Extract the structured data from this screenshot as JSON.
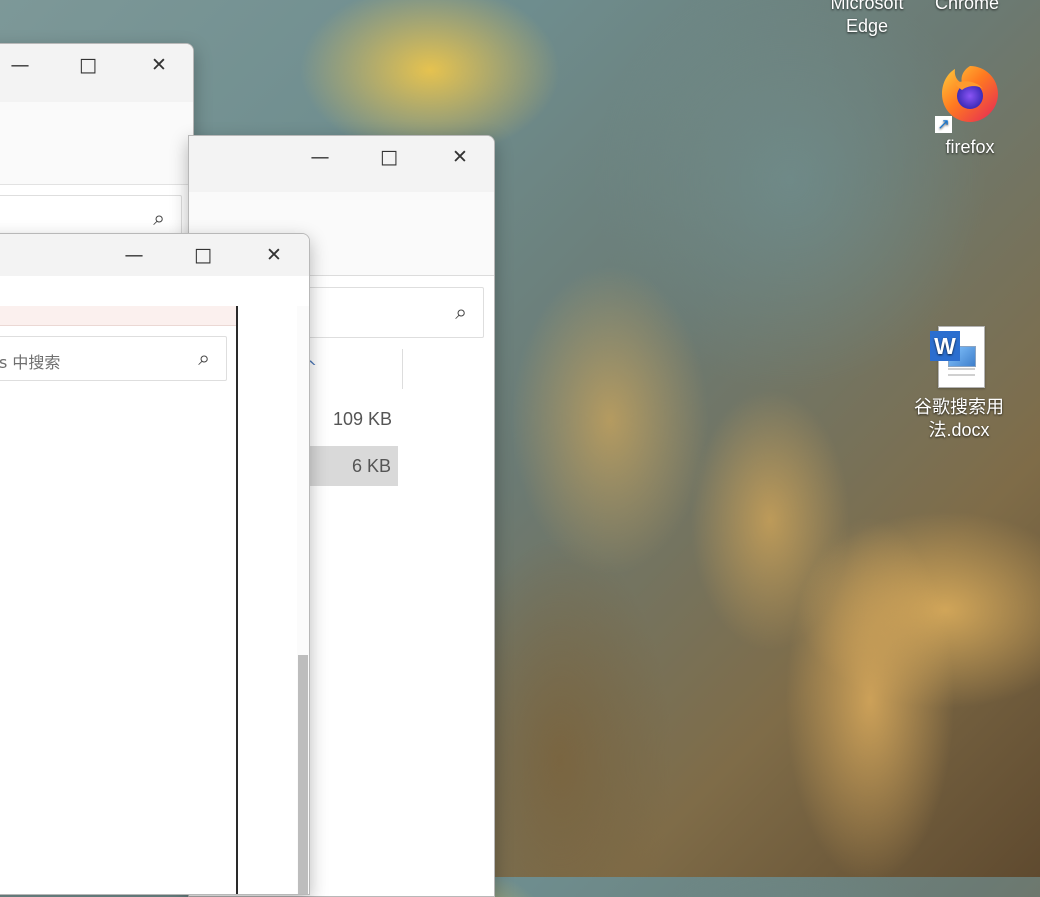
{
  "desktop": {
    "icons": [
      {
        "label_line1": "Microsoft",
        "label_line2": "Edge",
        "icon": "edge-icon"
      },
      {
        "label": "Chrome",
        "icon": "chrome-icon"
      },
      {
        "label": "firefox",
        "icon": "firefox-icon",
        "shortcut_overlay": "shortcut-arrow-icon"
      },
      {
        "label_line1": "谷歌搜索用",
        "label_line2": "法.docx",
        "icon": "word-document-icon"
      }
    ]
  },
  "windows": {
    "back": {
      "caption_buttons": {
        "minimize": "—",
        "maximize": "□",
        "close": "✕"
      },
      "search_icon": "⌕"
    },
    "middle": {
      "caption_buttons": {
        "minimize": "—",
        "maximize": "□",
        "close": "✕"
      },
      "search_icon": "⌕",
      "sort_indicator": "^",
      "file_sizes": [
        "109 KB",
        "6 KB"
      ]
    },
    "front": {
      "caption_buttons": {
        "minimize": "—",
        "maximize": "□",
        "close": "✕"
      },
      "search_placeholder": "s 中搜索",
      "search_icon": "⌕"
    }
  },
  "colors": {
    "window_bg": "#ffffff",
    "titlebar_bg": "#f3f3f3",
    "selection_bg": "#d9d9d9",
    "scrollbar_thumb": "#bdbdbd"
  }
}
